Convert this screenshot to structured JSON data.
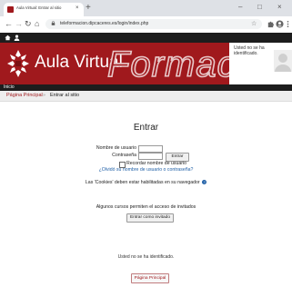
{
  "browser": {
    "tab_title": "Aula Virtual: Entrar al sitio",
    "tab_close": "×",
    "new_tab": "+",
    "url": "teleformacion.dipcaceres.es/login/index.php",
    "window_controls": {
      "minimize": "–",
      "restore": "□",
      "close": "×"
    },
    "nav": {
      "back": "←",
      "forward": "→",
      "reload": "↻",
      "home": "⌂"
    },
    "star": "☆"
  },
  "header": {
    "brand": "Aula Virtual",
    "banner": "Formación",
    "user_status": "Usted no se ha identificado."
  },
  "nav": {
    "home_label": "Inicio",
    "breadcrumb_home": "Página Principal",
    "breadcrumb_sep": "»",
    "breadcrumb_current": "Entrar al sitio"
  },
  "login": {
    "title": "Entrar",
    "username_label": "Nombre de usuario",
    "password_label": "Contraseña",
    "submit_label": "Entrar",
    "remember_label": "Recordar nombre de usuario",
    "forgot_link": "¿Olvidó su nombre de usuario o contraseña?",
    "cookies_note": "Las 'Cookies' deben estar habilitadas en su navegador",
    "help_icon": "?",
    "guest_note": "Algunos cursos permiten el acceso de invitados",
    "guest_button": "Entrar como invitado"
  },
  "footer": {
    "not_logged": "Usted no se ha identificado.",
    "home_button": "Página Principal"
  },
  "colors": {
    "brand_red": "#a0191d",
    "dark_bar": "#1d1d1d",
    "link_blue": "#1f5fa6"
  }
}
